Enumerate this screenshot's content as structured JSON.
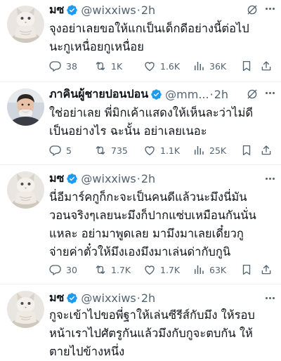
{
  "tweets": [
    {
      "name": "มซ",
      "handle": "@wixxiws",
      "time": "2h",
      "lines": [
        "จุงอย่าเลยขอให้แกเป็นเด็กดีอย่างนี้ต่อไป",
        "นะกูเหนื่อยกูเหนื่อย"
      ],
      "replies": "38",
      "retweets": "1K",
      "likes": "1.6K",
      "views": "36K",
      "avatar": "cat"
    },
    {
      "name": "ภาคินผู้ชายปอนปอน",
      "handle": "@mm...",
      "time": "2h",
      "lines": [
        "ใช่อย่าเลย พี่มิกเค้าแสดงให้เห็นละว่าไม่ดี",
        "เป็นอย่างไร ฉะนั้น อย่าเลยเนอะ"
      ],
      "replies": "5",
      "retweets": "735",
      "likes": "1.1K",
      "views": "25K",
      "avatar": "person"
    },
    {
      "name": "มซ",
      "handle": "@wixxiws",
      "time": "2h",
      "lines": [
        "นี่อีมาร์คกูก็กะจะเป็นคนดีแล้วนะมึงนี่มัน",
        "วอนจริงๆเลยนะมึงก็ปากแซ่บเหมือนกันนั่น",
        "แหละ อย่ามาพูดเลย มามึงมาเลยเดี๋ยวกู",
        "จ่ายค่าตั๋วให้มึงเองมึงมาเล่นด่ากับกูนิ"
      ],
      "replies": "30",
      "retweets": "1.7K",
      "likes": "1.7K",
      "views": "63K",
      "avatar": "cat"
    },
    {
      "name": "มซ",
      "handle": "@wixxiws",
      "time": "2h",
      "lines": [
        "กูจะเข้าไปขอพี่ฐาให้เล่นซีรีส์กับมึง ให้รอบ",
        "หน้าเราไปศัตรูกันแล้วมึงกับกูจะตบกัน ให้",
        "ตายไปข้างหนึ่ง"
      ],
      "avatar": "cat"
    }
  ],
  "colors": {
    "verified": "#1d9bf0",
    "text": "#0f1419",
    "muted": "#536471",
    "separator": "#eff3f4"
  },
  "icons": [
    "verified-badge-icon",
    "grok-icon",
    "more-icon",
    "reply-icon",
    "retweet-icon",
    "like-icon",
    "views-icon",
    "bookmark-icon",
    "share-icon"
  ]
}
